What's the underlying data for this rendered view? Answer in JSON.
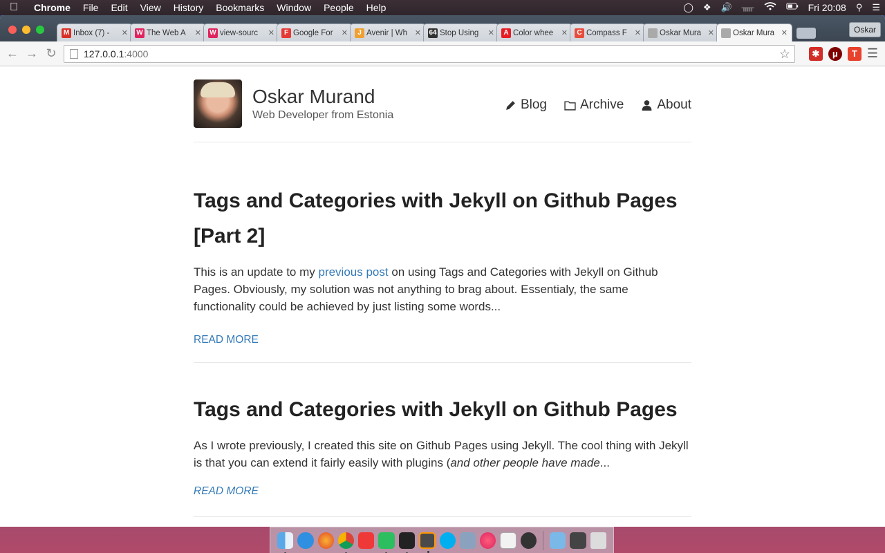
{
  "menubar": {
    "app_name": "Chrome",
    "items": [
      "File",
      "Edit",
      "View",
      "History",
      "Bookmarks",
      "Window",
      "People",
      "Help"
    ],
    "clock": "Fri 20:08"
  },
  "browser": {
    "tabs": [
      {
        "label": "Inbox (7) - ",
        "favicon": "gmail-icon",
        "color": "#d93025",
        "glyph": "M"
      },
      {
        "label": "The Web A",
        "favicon": "w-icon",
        "color": "#e0245e",
        "glyph": "W"
      },
      {
        "label": "view-sourc",
        "favicon": "w-icon",
        "color": "#e0245e",
        "glyph": "W"
      },
      {
        "label": "Google For",
        "favicon": "google-fonts-icon",
        "color": "#e53935",
        "glyph": "F"
      },
      {
        "label": "Avenir | Wh",
        "favicon": "j-icon",
        "color": "#f0a030",
        "glyph": "J"
      },
      {
        "label": "Stop Using",
        "favicon": "64-icon",
        "color": "#333333",
        "glyph": "64"
      },
      {
        "label": "Color whee",
        "favicon": "adobe-icon",
        "color": "#e81c24",
        "glyph": "A"
      },
      {
        "label": "Compass F",
        "favicon": "compass-icon",
        "color": "#e74c3c",
        "glyph": "C"
      },
      {
        "label": "Oskar Mura",
        "favicon": "page-icon",
        "color": "#aaaaaa",
        "glyph": ""
      },
      {
        "label": "Oskar Mura",
        "favicon": "page-icon",
        "color": "#aaaaaa",
        "glyph": "",
        "active": true
      }
    ],
    "profile_name": "Oskar",
    "url_host": "127.0.0.1",
    "url_port": ":4000"
  },
  "site": {
    "title": "Oskar Murand",
    "subtitle": "Web Developer from Estonia",
    "nav": {
      "blog": "Blog",
      "archive": "Archive",
      "about": "About"
    }
  },
  "posts": [
    {
      "title": "Tags and Categories with Jekyll on Github Pages [Part 2]",
      "excerpt_before": "This is an update to my ",
      "excerpt_link": "previous post",
      "excerpt_after": " on using Tags and Categories with Jekyll on Github Pages. Obviously, my solution was not anything to brag about. Essentialy, the same functionality could be achieved by just listing some words...",
      "read_more": "READ MORE"
    },
    {
      "title": "Tags and Categories with Jekyll on Github Pages",
      "excerpt_before": "As I wrote previously, I created this site on Github Pages using Jekyll. The cool thing with Jekyll is that you can extend it fairly easily with plugins (",
      "excerpt_italic": "and other people have made",
      "excerpt_after": "...",
      "read_more": "READ MORE"
    }
  ],
  "colors": {
    "link": "#337ab7",
    "heading": "#222222"
  }
}
